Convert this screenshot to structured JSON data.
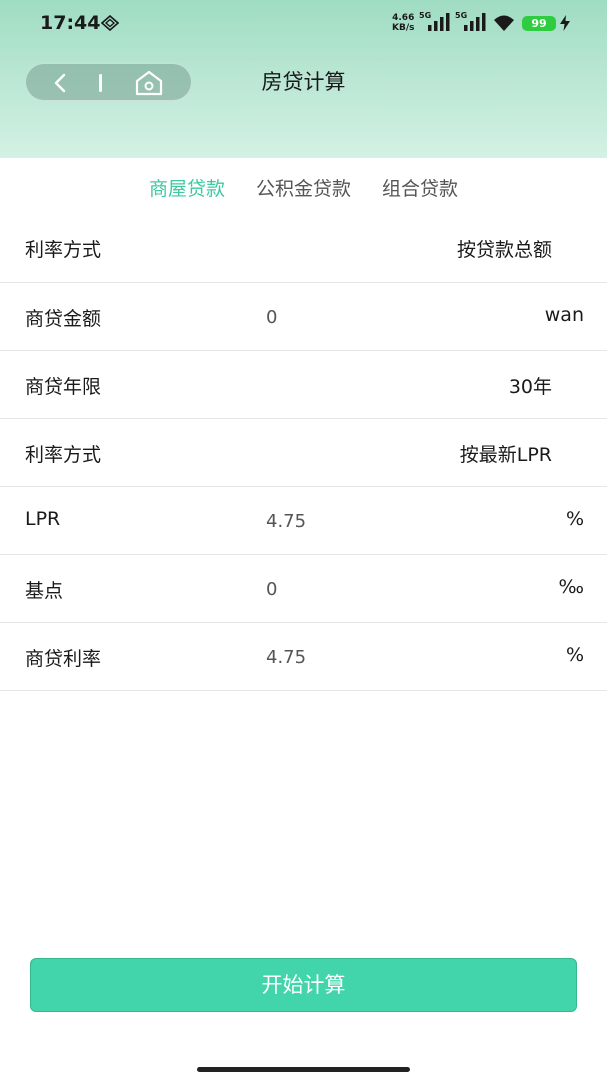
{
  "status_bar": {
    "time": "17:44",
    "net_speed_value": "4.66",
    "net_speed_unit": "KB/s",
    "sim1_label": "5G",
    "sim2_label": "5G",
    "battery": "99"
  },
  "header": {
    "title": "房贷计算"
  },
  "tabs": [
    {
      "label": "商屋贷款",
      "active": true
    },
    {
      "label": "公积金贷款",
      "active": false
    },
    {
      "label": "组合贷款",
      "active": false
    }
  ],
  "rows": {
    "rate_mode_1": {
      "label": "利率方式",
      "value": "按贷款总额"
    },
    "loan_amount": {
      "label": "商贷金额",
      "value": "0",
      "unit": "wan"
    },
    "loan_term": {
      "label": "商贷年限",
      "value": "30年"
    },
    "rate_mode_2": {
      "label": "利率方式",
      "value": "按最新LPR"
    },
    "lpr": {
      "label": "LPR",
      "value": "4.75",
      "unit": "%"
    },
    "basis_points": {
      "label": "基点",
      "value": "0",
      "unit": "‰"
    },
    "loan_rate": {
      "label": "商贷利率",
      "value": "4.75",
      "unit": "%"
    }
  },
  "actions": {
    "calculate_label": "开始计算"
  },
  "colors": {
    "accent": "#3fc9a0",
    "button": "#42d4aa",
    "header_top": "#9fdcc2"
  }
}
